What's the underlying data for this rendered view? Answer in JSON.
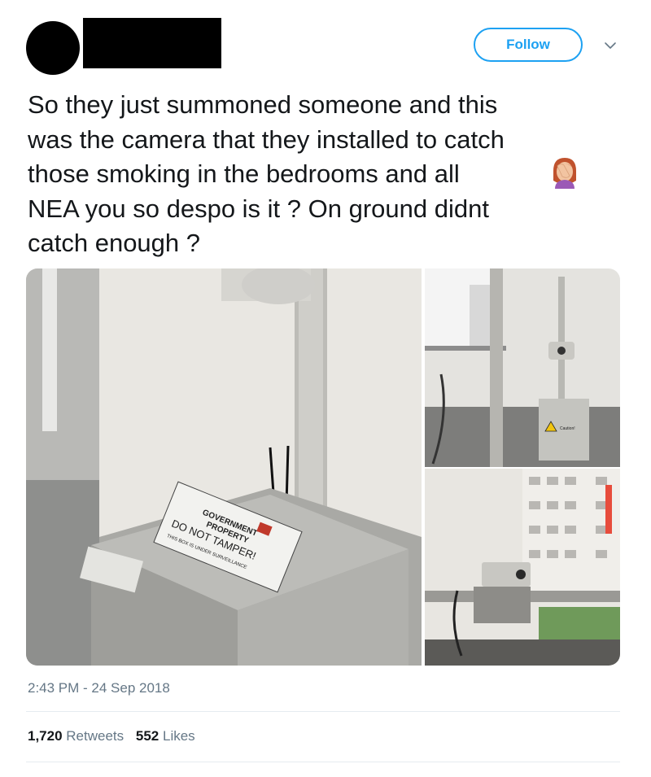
{
  "header": {
    "follow_label": "Follow"
  },
  "tweet": {
    "text": "So they just summoned someone and this\nwas the camera that they installed to catch\nthose smoking in the bedrooms and all\nNEA you so despo is it ? On ground didnt\ncatch enough ?",
    "emoji_icon": "facepalm-icon",
    "timestamp": "2:43 PM - 24 Sep 2018"
  },
  "media": {
    "sign_line1": "GOVERNMENT",
    "sign_line2": "PROPERTY",
    "sign_line3": "DO NOT TAMPER!",
    "sign_line4": "THIS BOX IS UNDER SURVEILLANCE",
    "caution_label": "Caution!"
  },
  "stats": {
    "retweets_count": "1,720",
    "retweets_label": "Retweets",
    "likes_count": "552",
    "likes_label": "Likes"
  },
  "colors": {
    "accent": "#1da1f2",
    "muted": "#657786",
    "text": "#14171a"
  }
}
